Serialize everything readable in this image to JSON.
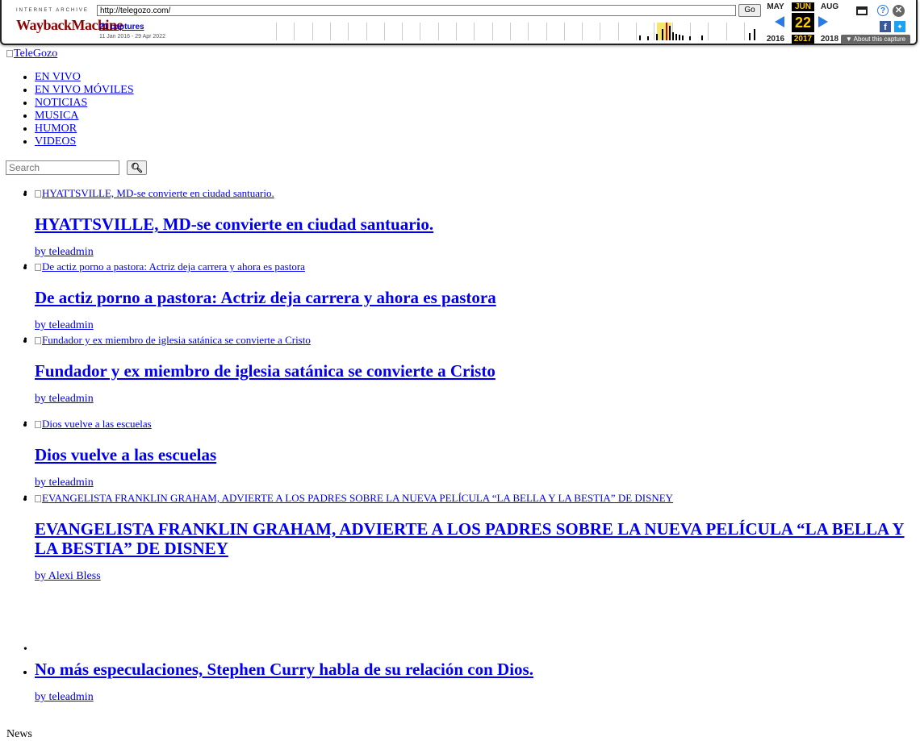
{
  "wayback": {
    "logo_small": "INTERNET ARCHIVE",
    "logo_big": "WaybackMachine",
    "url": "http://telegozo.com/",
    "go_label": "Go",
    "captures": "21 captures",
    "range": "11 Jan 2016 - 29 Apr 2022",
    "months": [
      "MAY",
      "JUN",
      "AUG"
    ],
    "day": "22",
    "years": [
      "2016",
      "2017",
      "2018"
    ],
    "about": "▼ About this capture",
    "icons": [
      "window-icon",
      "help-icon",
      "close-icon",
      "facebook-icon",
      "twitter-icon",
      "prev-arrow-icon",
      "next-arrow-icon"
    ],
    "colors": {
      "highlight": "#ffcc00",
      "arrow": "#2a7ae2",
      "selected_bar": "#f5e56b"
    }
  },
  "site": {
    "logo_alt": "TeleGozo",
    "nav": [
      "EN VIVO",
      "EN VIVO MÓVILES",
      "NOTICIAS",
      "MUSICA",
      "HUMOR",
      "VIDEOS"
    ],
    "search_placeholder": "Search",
    "search_icon": "magnifier-icon",
    "footer_label": "News"
  },
  "posts": [
    {
      "thumb_alt": "HYATTSVILLE, MD-se convierte en ciudad santuario.",
      "title": "HYATTSVILLE, MD-se convierte en ciudad santuario.",
      "byline": "by teleadmin"
    },
    {
      "thumb_alt": "De actiz porno a pastora: Actriz deja carrera y ahora es pastora",
      "title": "De actiz porno a pastora: Actriz deja carrera y ahora es pastora",
      "byline": "by teleadmin"
    },
    {
      "thumb_alt": "Fundador y ex miembro de iglesia satánica se convierte a Cristo",
      "title": "Fundador y ex miembro de iglesia satánica se convierte a Cristo",
      "byline": "by teleadmin"
    },
    {
      "thumb_alt": "Dios vuelve a las escuelas",
      "title": "Dios vuelve a las escuelas",
      "byline": "by teleadmin"
    },
    {
      "thumb_alt": "EVANGELISTA FRANKLIN GRAHAM, ADVIERTE A LOS PADRES SOBRE LA NUEVA PELÍCULA “LA BELLA Y LA BESTIA” DE DISNEY",
      "title": "EVANGELISTA FRANKLIN GRAHAM, ADVIERTE A LOS PADRES SOBRE LA NUEVA PELÍCULA “LA BELLA Y LA BESTIA” DE DISNEY",
      "byline": "by Alexi Bless"
    },
    {
      "thumb_alt": "",
      "title": "No más especulaciones, Stephen Curry habla de su relación con Dios.",
      "byline": "by teleadmin"
    }
  ]
}
